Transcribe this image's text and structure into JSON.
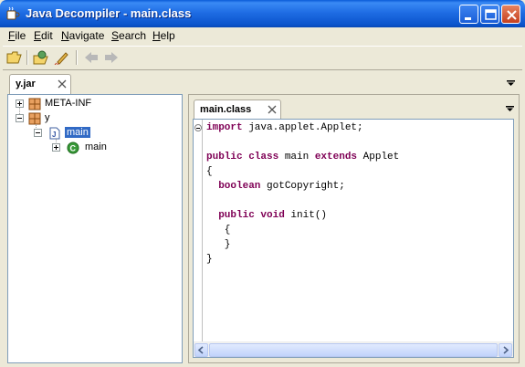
{
  "window": {
    "title": "Java Decompiler - main.class",
    "icon": "coffee-cup-icon"
  },
  "menubar": {
    "items": [
      {
        "label": "File",
        "mnemonic": "F"
      },
      {
        "label": "Edit",
        "mnemonic": "E"
      },
      {
        "label": "Navigate",
        "mnemonic": "N"
      },
      {
        "label": "Search",
        "mnemonic": "S"
      },
      {
        "label": "Help",
        "mnemonic": "H"
      }
    ]
  },
  "toolbar": {
    "icons": [
      "open-folder-icon",
      "open-type-icon",
      "search-rocket-icon",
      "back-arrow-icon",
      "forward-arrow-icon"
    ]
  },
  "outer_tab": {
    "label": "y.jar"
  },
  "tree": {
    "nodes": [
      {
        "label": "META-INF",
        "icon": "package-icon",
        "expanded": false
      },
      {
        "label": "y",
        "icon": "package-icon",
        "expanded": true
      },
      {
        "label": "main",
        "icon": "java-file-icon",
        "expanded": true,
        "selected": true
      },
      {
        "label": "main",
        "icon": "class-c-icon",
        "expanded": false
      }
    ]
  },
  "editor": {
    "tab_label": "main.class",
    "code_lines": [
      {
        "kw": "import",
        "rest": " java.applet.Applet;"
      },
      {
        "kw": "",
        "rest": ""
      },
      {
        "kw": "public class",
        "rest": " main ",
        "kw2": "extends",
        "rest2": " Applet"
      },
      {
        "kw": "",
        "rest": "{"
      },
      {
        "kw": "  boolean",
        "rest": " gotCopyright;"
      },
      {
        "kw": "",
        "rest": ""
      },
      {
        "kw": "  public void",
        "rest": " init()"
      },
      {
        "kw": "",
        "rest": "   {"
      },
      {
        "kw": "",
        "rest": "   }"
      },
      {
        "kw": "",
        "rest": "}"
      }
    ]
  },
  "colors": {
    "titlebar": "#0b54cc",
    "keyword": "#7f0055",
    "selection": "#316ac5"
  }
}
